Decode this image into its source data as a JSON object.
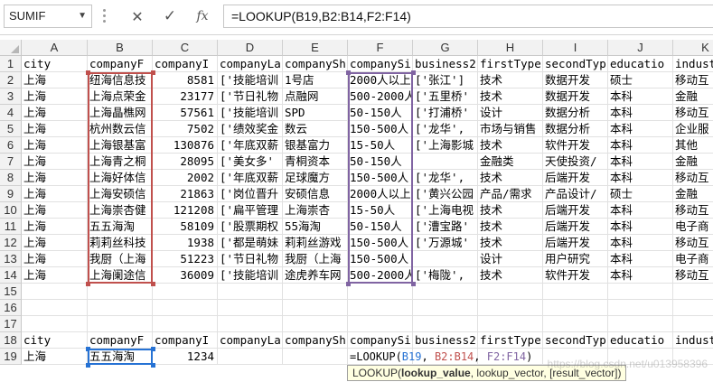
{
  "formula_bar": {
    "name_box": "SUMIF",
    "cancel_icon": "✕",
    "enter_icon": "✓",
    "fx_icon": "fx",
    "formula": "=LOOKUP(B19,B2:B14,F2:F14)"
  },
  "columns": [
    "A",
    "B",
    "C",
    "D",
    "E",
    "F",
    "G",
    "H",
    "I",
    "J",
    "K"
  ],
  "rows": [
    {
      "n": "1",
      "cells": [
        "city",
        "companyF",
        "companyI",
        "companyLa",
        "companySh",
        "companySi",
        "business2",
        "firstType",
        "secondTyp",
        "educatio",
        "indust"
      ]
    },
    {
      "n": "2",
      "cells": [
        "上海",
        "纽海信息技",
        "8581",
        "['技能培训",
        "1号店",
        "2000人以上",
        "['张江']",
        "技术",
        "数据开发",
        "硕士",
        "移动互"
      ]
    },
    {
      "n": "3",
      "cells": [
        "上海",
        "上海点荣金",
        "23177",
        "['节日礼物",
        "点融网",
        "500-2000人",
        "['五里桥'",
        "技术",
        "数据开发",
        "本科",
        "金融"
      ]
    },
    {
      "n": "4",
      "cells": [
        "上海",
        "上海晶樵网",
        "57561",
        "['技能培训",
        "SPD",
        "50-150人",
        "['打浦桥'",
        "设计",
        "数据分析",
        "本科",
        "移动互"
      ]
    },
    {
      "n": "5",
      "cells": [
        "上海",
        "杭州数云信",
        "7502",
        "['绩效奖金",
        "数云",
        "150-500人",
        "['龙华',",
        "市场与销售",
        "数据分析",
        "本科",
        "企业服"
      ]
    },
    {
      "n": "6",
      "cells": [
        "上海",
        "上海银基富",
        "130876",
        "['年底双薪",
        "银基富力",
        "15-50人",
        "['上海影城",
        "技术",
        "软件开发",
        "本科",
        "其他"
      ]
    },
    {
      "n": "7",
      "cells": [
        "上海",
        "上海青之桐",
        "28095",
        "['美女多'",
        "青桐资本",
        "50-150人",
        "",
        "金融类",
        "天使投资/",
        "本科",
        "金融"
      ]
    },
    {
      "n": "8",
      "cells": [
        "上海",
        "上海好体信",
        "2002",
        "['年底双薪",
        "足球魔方",
        "150-500人",
        "['龙华',",
        "技术",
        "后端开发",
        "本科",
        "移动互"
      ]
    },
    {
      "n": "9",
      "cells": [
        "上海",
        "上海安硕信",
        "21863",
        "['岗位晋升",
        "安硕信息",
        "2000人以上",
        "['黄兴公园",
        "产品/需求",
        "产品设计/",
        "硕士",
        "金融"
      ]
    },
    {
      "n": "10",
      "cells": [
        "上海",
        "上海崇杏健",
        "121208",
        "['扁平管理",
        "上海崇杏",
        "15-50人",
        "['上海电视",
        "技术",
        "后端开发",
        "本科",
        "移动互"
      ]
    },
    {
      "n": "11",
      "cells": [
        "上海",
        "五五海淘",
        "58109",
        "['股票期权",
        "55海淘",
        "50-150人",
        "['漕宝路'",
        "技术",
        "后端开发",
        "本科",
        "电子商"
      ]
    },
    {
      "n": "12",
      "cells": [
        "上海",
        "莉莉丝科技",
        "1938",
        "['都是萌妹",
        "莉莉丝游戏",
        "150-500人",
        "['万源城'",
        "技术",
        "后端开发",
        "本科",
        "移动互"
      ]
    },
    {
      "n": "13",
      "cells": [
        "上海",
        "我厨（上海",
        "51223",
        "['节日礼物",
        "我厨（上海",
        "150-500人",
        "",
        "设计",
        "用户研究",
        "本科",
        "电子商"
      ]
    },
    {
      "n": "14",
      "cells": [
        "上海",
        "上海阑途信",
        "36009",
        "['技能培训",
        "途虎养车网",
        "500-2000人",
        "['梅陇',",
        "技术",
        "软件开发",
        "本科",
        "移动互"
      ]
    },
    {
      "n": "15",
      "cells": [
        "",
        "",
        "",
        "",
        "",
        "",
        "",
        "",
        "",
        "",
        ""
      ]
    },
    {
      "n": "16",
      "cells": [
        "",
        "",
        "",
        "",
        "",
        "",
        "",
        "",
        "",
        "",
        ""
      ]
    },
    {
      "n": "17",
      "cells": [
        "",
        "",
        "",
        "",
        "",
        "",
        "",
        "",
        "",
        "",
        ""
      ]
    },
    {
      "n": "18",
      "cells": [
        "city",
        "companyF",
        "companyI",
        "companyLa",
        "companySh",
        "companySi",
        "business2",
        "firstType",
        "secondTyp",
        "educatio",
        "indust"
      ]
    },
    {
      "n": "19",
      "cells": [
        "上海",
        "五五海淘",
        "1234",
        "",
        "",
        "=LOOKUP(B19, B2:B14, F2:F14)",
        "",
        "",
        "",
        "",
        ""
      ]
    }
  ],
  "formula_parts": {
    "prefix": "=LOOKUP(",
    "ref1": "B19",
    "sep1": ", ",
    "ref2": "B2:B14",
    "sep2": ", ",
    "ref3": "F2:F14",
    "suffix": ")"
  },
  "tooltip": {
    "fn": "LOOKUP(",
    "arg1": "lookup_value",
    "rest": ", lookup_vector, [result_vector])"
  },
  "watermark": "https://blog.csdn.net/u013958396",
  "colors": {
    "ref1": "#2672d4",
    "ref2": "#c0504d",
    "ref3": "#8064a2",
    "header_bg": "#f2f2f2",
    "grid": "#e1e1e1"
  }
}
